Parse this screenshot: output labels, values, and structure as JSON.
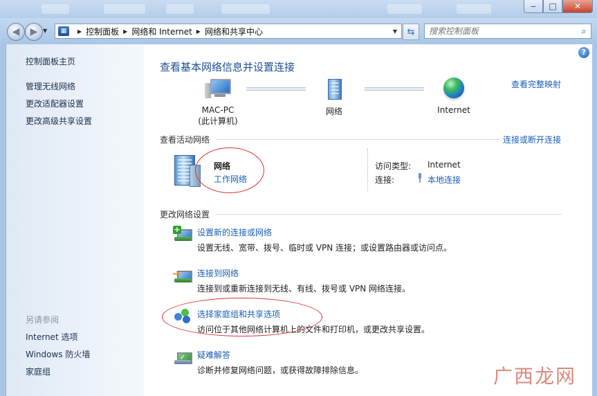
{
  "titlebar": {
    "minimize": "‒",
    "maximize": "□",
    "close": "✕"
  },
  "breadcrumb": [
    "控制面板",
    "网络和 Internet",
    "网络和共享中心"
  ],
  "search": {
    "placeholder": "搜索控制面板"
  },
  "sidebar": {
    "links": [
      "控制面板主页",
      "管理无线网络",
      "更改适配器设置",
      "更改高级共享设置"
    ],
    "see_also_heading": "另请参阅",
    "see_also": [
      "Internet 选项",
      "Windows 防火墙",
      "家庭组"
    ]
  },
  "main": {
    "title": "查看基本网络信息并设置连接",
    "view_full_map": "查看完整映射",
    "map": {
      "computer_name": "MAC-PC",
      "computer_sub": "(此计算机)",
      "network": "网络",
      "internet": "Internet"
    },
    "active_networks_label": "查看活动网络",
    "connect_disconnect": "连接或断开连接",
    "active_network": {
      "name": "网络",
      "type_link": "工作网络",
      "access_type_label": "访问类型:",
      "access_type_value": "Internet",
      "connections_label": "连接:",
      "connections_value": "本地连接"
    },
    "change_settings_label": "更改网络设置",
    "tasks": [
      {
        "title": "设置新的连接或网络",
        "desc": "设置无线、宽带、拨号、临时或 VPN 连接；或设置路由器或访问点。"
      },
      {
        "title": "连接到网络",
        "desc": "连接到或重新连接到无线、有线、拨号或 VPN 网络连接。"
      },
      {
        "title": "选择家庭组和共享选项",
        "desc": "访问位于其他网络计算机上的文件和打印机，或更改共享设置。"
      },
      {
        "title": "疑难解答",
        "desc": "诊断并修复网络问题，或获得故障排除信息。"
      }
    ]
  },
  "watermark": "广西龙网",
  "colors": {
    "link": "#1a5fb4",
    "title": "#1d4f8f",
    "annotation": "#e03030"
  }
}
